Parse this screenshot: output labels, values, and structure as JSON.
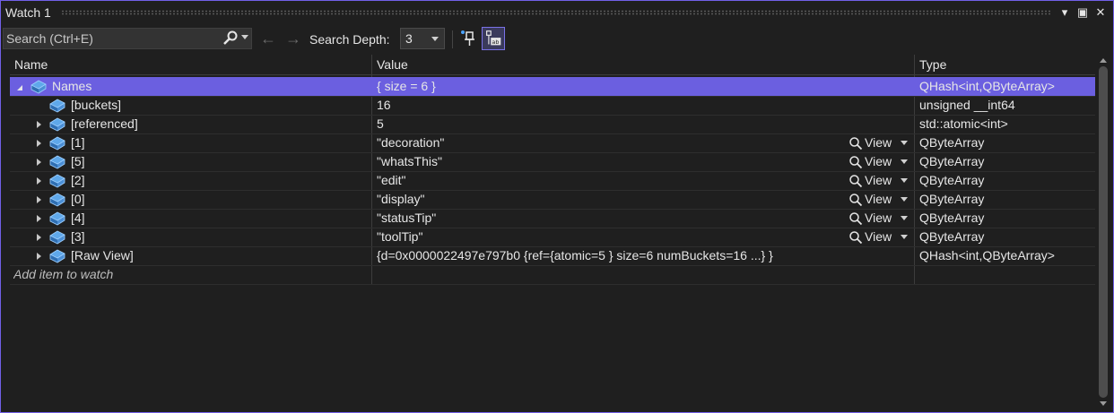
{
  "window": {
    "title": "Watch 1",
    "buttons": {
      "dropdown": "▾",
      "maximize": "▣",
      "close": "✕"
    }
  },
  "toolbar": {
    "search_placeholder": "Search (Ctrl+E)",
    "search_depth_label": "Search Depth:",
    "search_depth_value": "3",
    "back_arrow": "←",
    "forward_arrow": "→"
  },
  "columns": {
    "name": "Name",
    "value": "Value",
    "type": "Type"
  },
  "rows": [
    {
      "name": "Names",
      "value": "{ size = 6 }",
      "type": "QHash<int,QByteArray>",
      "level": 0,
      "expander": "expanded",
      "selected": true,
      "viewer": false
    },
    {
      "name": "[buckets]",
      "value": "16",
      "type": "unsigned __int64",
      "level": 1,
      "expander": "none",
      "selected": false,
      "viewer": false
    },
    {
      "name": "[referenced]",
      "value": "5",
      "type": "std::atomic<int>",
      "level": 1,
      "expander": "collapsed",
      "selected": false,
      "viewer": false
    },
    {
      "name": "[1]",
      "value": "\"decoration\"",
      "type": "QByteArray",
      "level": 1,
      "expander": "collapsed",
      "selected": false,
      "viewer": true
    },
    {
      "name": "[5]",
      "value": "\"whatsThis\"",
      "type": "QByteArray",
      "level": 1,
      "expander": "collapsed",
      "selected": false,
      "viewer": true
    },
    {
      "name": "[2]",
      "value": "\"edit\"",
      "type": "QByteArray",
      "level": 1,
      "expander": "collapsed",
      "selected": false,
      "viewer": true
    },
    {
      "name": "[0]",
      "value": "\"display\"",
      "type": "QByteArray",
      "level": 1,
      "expander": "collapsed",
      "selected": false,
      "viewer": true
    },
    {
      "name": "[4]",
      "value": "\"statusTip\"",
      "type": "QByteArray",
      "level": 1,
      "expander": "collapsed",
      "selected": false,
      "viewer": true
    },
    {
      "name": "[3]",
      "value": "\"toolTip\"",
      "type": "QByteArray",
      "level": 1,
      "expander": "collapsed",
      "selected": false,
      "viewer": true
    },
    {
      "name": "[Raw View]",
      "value": "{d=0x0000022497e797b0 {ref={atomic=5 } size=6 numBuckets=16 ...} }",
      "type": "QHash<int,QByteArray>",
      "level": 1,
      "expander": "collapsed",
      "selected": false,
      "viewer": false
    }
  ],
  "viewer_label": "View",
  "add_item_placeholder": "Add item to watch",
  "colors": {
    "accent": "#7160e8",
    "selection": "#6b5fe0",
    "background": "#1f1f1f"
  }
}
